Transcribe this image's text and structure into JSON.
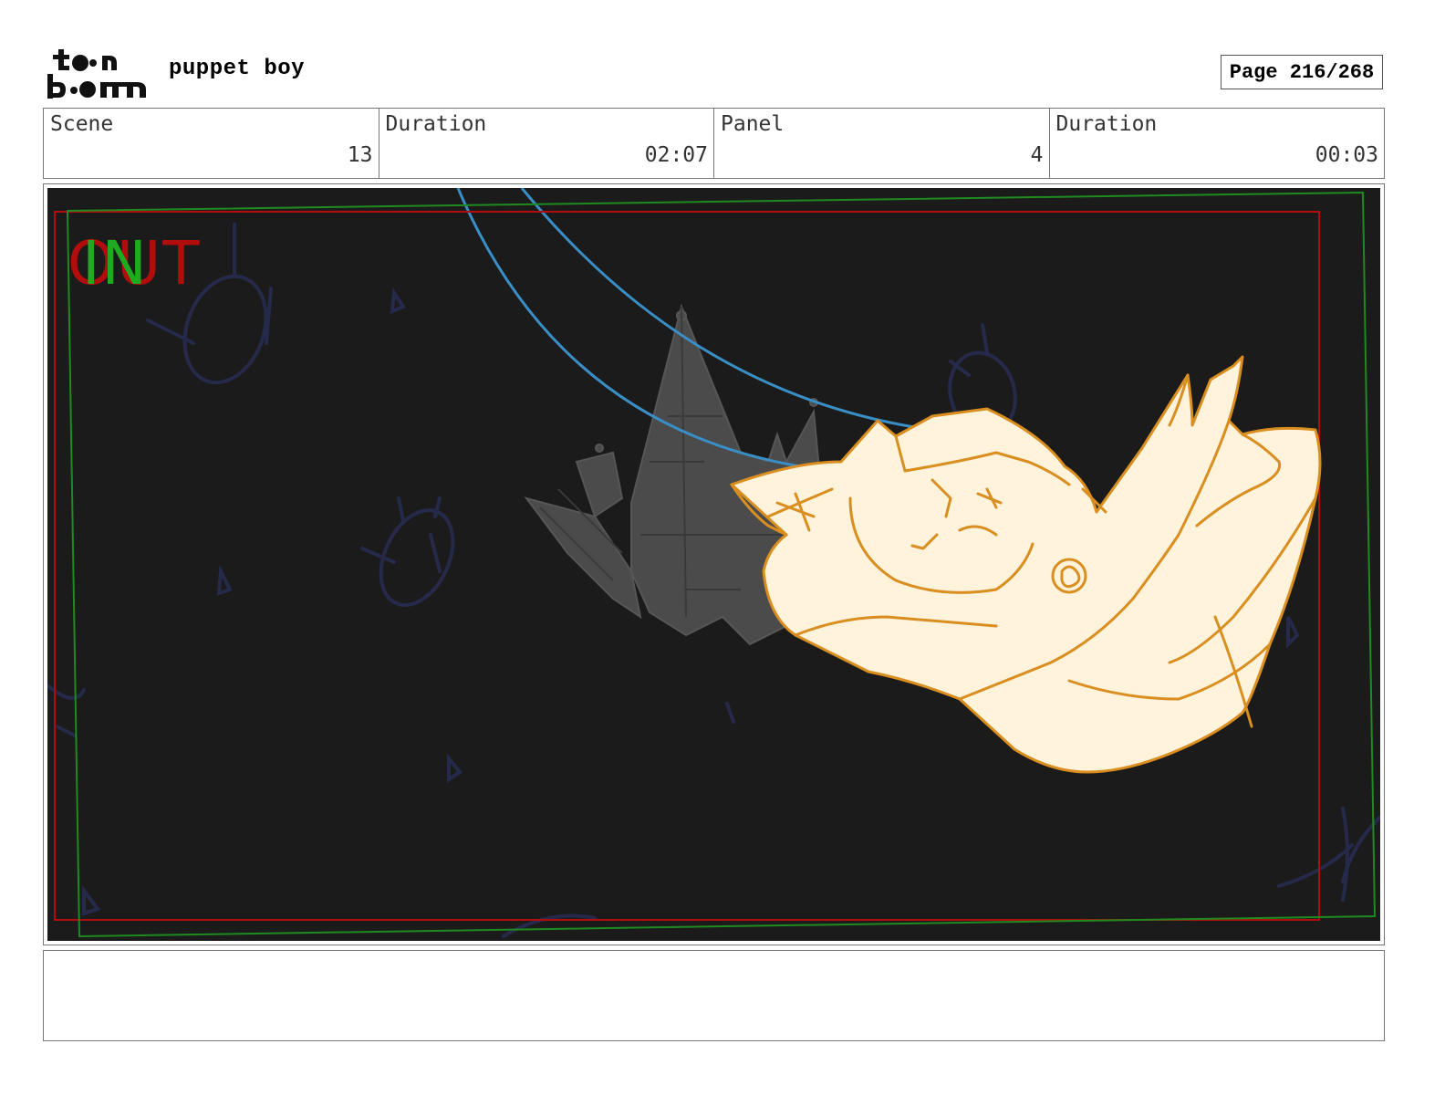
{
  "header": {
    "logo_text": "toon boom",
    "project_title": "puppet boy",
    "page_label": "Page 216/268"
  },
  "info": {
    "scene_label": "Scene",
    "scene_value": "13",
    "scene_duration_label": "Duration",
    "scene_duration_value": "02:07",
    "panel_label": "Panel",
    "panel_value": "4",
    "panel_duration_label": "Duration",
    "panel_duration_value": "00:03"
  },
  "panel": {
    "transition_out": "OUT",
    "transition_in": "IN",
    "colors": {
      "background": "#1b1b1b",
      "character_fill": "#fff3dc",
      "character_line": "#d98e1f",
      "camera_path": "#3a8ec6",
      "safe_frame_red": "#b10d0d",
      "safe_frame_green": "#1f8a1f",
      "background_doodles": "#262a4a",
      "castle": "#4e4e4e"
    }
  },
  "notes": {
    "text": ""
  }
}
